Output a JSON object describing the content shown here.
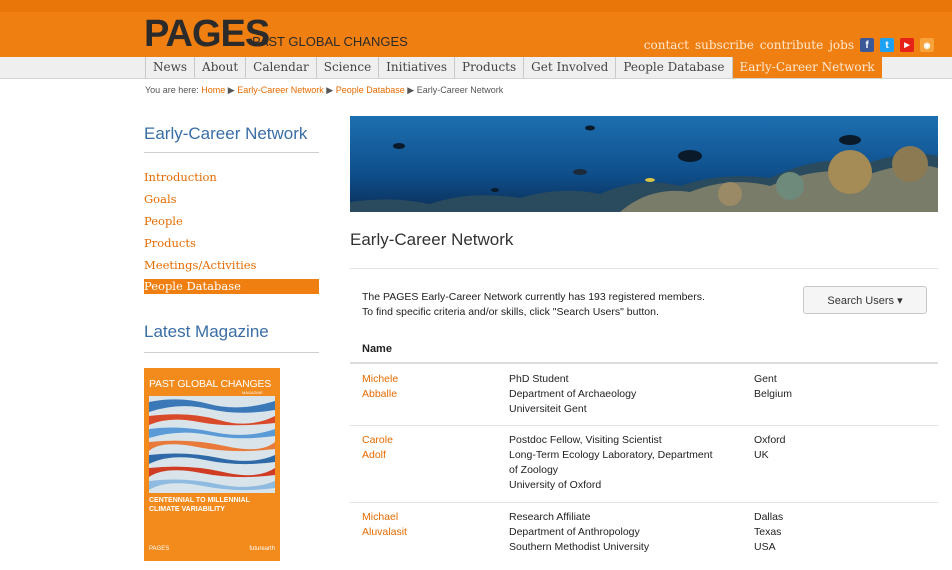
{
  "header": {
    "logo_text": "PAGES",
    "logo_sub": "PAST GLOBAL CHANGES",
    "utility_links": [
      "contact",
      "subscribe",
      "contribute",
      "jobs"
    ],
    "social_icons": [
      {
        "name": "facebook-icon",
        "glyph": "f",
        "color": "#3b5998"
      },
      {
        "name": "twitter-icon",
        "glyph": "t",
        "color": "#1da1f2"
      },
      {
        "name": "youtube-icon",
        "glyph": "▶",
        "color": "#e62117"
      },
      {
        "name": "rss-icon",
        "glyph": "◉",
        "color": "#f07f12"
      }
    ]
  },
  "nav": {
    "items": [
      "News",
      "About",
      "Calendar",
      "Science",
      "Initiatives",
      "Products",
      "Get Involved",
      "People Database",
      "Early-Career Network"
    ],
    "active_index": 8
  },
  "breadcrumb": {
    "prefix": "You are here:",
    "links": [
      "Home",
      "Early-Career Network",
      "People Database"
    ],
    "current": "Early-Career Network",
    "separator": "▶"
  },
  "sidebar": {
    "title": "Early-Career Network",
    "items": [
      "Introduction",
      "Goals",
      "People",
      "Products",
      "Meetings/Activities",
      "People Database"
    ],
    "active_index": 5,
    "magazine_title": "Latest Magazine",
    "cover": {
      "title": "PAST GLOBAL CHANGES",
      "subtitle": "MAGAZINE",
      "headline": "CENTENNIAL TO MILLENNIAL CLIMATE VARIABILITY",
      "footer_left": "PAGES",
      "footer_right": "futurearth"
    }
  },
  "main": {
    "page_title": "Early-Career Network",
    "intro_line1": "The PAGES Early-Career Network currently has 193 registered members.",
    "intro_line2": "To find specific criteria and/or skills, click \"Search Users\" button.",
    "search_button": "Search Users ▾",
    "table_header": "Name",
    "members": [
      {
        "first": "Michele",
        "last": "Abballe",
        "role": [
          "PhD Student",
          "Department of Archaeology",
          "Universiteit Gent"
        ],
        "loc": [
          "Gent",
          "Belgium"
        ]
      },
      {
        "first": "Carole",
        "last": "Adolf",
        "role": [
          "Postdoc Fellow, Visiting Scientist",
          "Long-Term Ecology Laboratory, Department",
          "of Zoology",
          "University of Oxford"
        ],
        "loc": [
          "Oxford",
          "UK"
        ]
      },
      {
        "first": "Michael",
        "last": "Aluvalasit",
        "role": [
          "Research Affiliate",
          "Department of Anthropology",
          "Southern Methodist University"
        ],
        "loc": [
          "Dallas",
          "Texas",
          "USA"
        ]
      }
    ]
  }
}
